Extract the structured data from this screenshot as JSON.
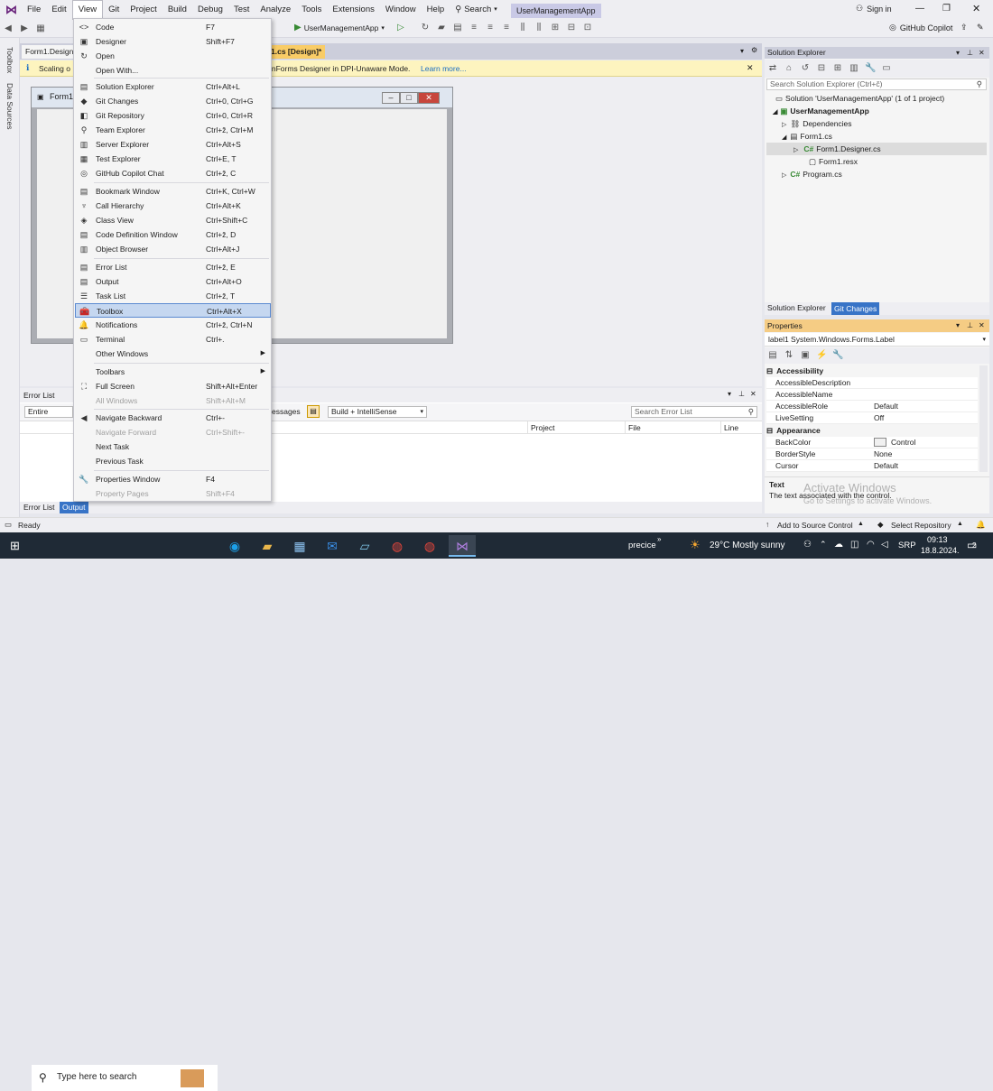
{
  "menubar": {
    "items": [
      "File",
      "Edit",
      "View",
      "Git",
      "Project",
      "Build",
      "Debug",
      "Test",
      "Analyze",
      "Tools",
      "Extensions",
      "Window",
      "Help"
    ],
    "search": "Search",
    "app_title": "UserManagementApp",
    "sign_in": "Sign in",
    "copilot": "GitHub Copilot"
  },
  "toolbar": {
    "run_target": "UserManagementApp"
  },
  "left_strip": {
    "toolbox": "Toolbox",
    "data_sources": "Data Sources"
  },
  "doc": {
    "tab_designer": "Form1.Designe",
    "tab_cs": "1.cs [Design]*",
    "info_prefix": "Scaling o",
    "info_text": "inForms Designer in DPI-Unaware Mode.",
    "info_link": "Learn more...",
    "form_title": "Form1"
  },
  "view_menu": {
    "items": [
      {
        "label": "Code",
        "key": "F7",
        "icon": "<>"
      },
      {
        "label": "Designer",
        "key": "Shift+F7",
        "icon": "▣"
      },
      {
        "label": "Open",
        "key": "",
        "icon": "↻"
      },
      {
        "label": "Open With...",
        "key": "",
        "icon": ""
      },
      {
        "label": "Solution Explorer",
        "key": "Ctrl+Alt+L",
        "icon": "▤"
      },
      {
        "label": "Git Changes",
        "key": "Ctrl+0, Ctrl+G",
        "icon": "◆"
      },
      {
        "label": "Git Repository",
        "key": "Ctrl+0, Ctrl+R",
        "icon": "◧"
      },
      {
        "label": "Team Explorer",
        "key": "Ctrl+ž, Ctrl+M",
        "icon": "⚲"
      },
      {
        "label": "Server Explorer",
        "key": "Ctrl+Alt+S",
        "icon": "▥"
      },
      {
        "label": "Test Explorer",
        "key": "Ctrl+E, T",
        "icon": "▦"
      },
      {
        "label": "GitHub Copilot Chat",
        "key": "Ctrl+ž, C",
        "icon": "◎"
      },
      {
        "label": "Bookmark Window",
        "key": "Ctrl+K, Ctrl+W",
        "icon": "▤"
      },
      {
        "label": "Call Hierarchy",
        "key": "Ctrl+Alt+K",
        "icon": "♆"
      },
      {
        "label": "Class View",
        "key": "Ctrl+Shift+C",
        "icon": "◈"
      },
      {
        "label": "Code Definition Window",
        "key": "Ctrl+ž, D",
        "icon": "▤"
      },
      {
        "label": "Object Browser",
        "key": "Ctrl+Alt+J",
        "icon": "▥"
      },
      {
        "label": "Error List",
        "key": "Ctrl+ž, E",
        "icon": "▤"
      },
      {
        "label": "Output",
        "key": "Ctrl+Alt+O",
        "icon": "▤"
      },
      {
        "label": "Task List",
        "key": "Ctrl+ž, T",
        "icon": "☰"
      },
      {
        "label": "Toolbox",
        "key": "Ctrl+Alt+X",
        "icon": "🧰"
      },
      {
        "label": "Notifications",
        "key": "Ctrl+ž, Ctrl+N",
        "icon": "🔔"
      },
      {
        "label": "Terminal",
        "key": "Ctrl+.",
        "icon": "▭"
      },
      {
        "label": "Other Windows",
        "key": "",
        "icon": ""
      },
      {
        "label": "Toolbars",
        "key": "",
        "icon": ""
      },
      {
        "label": "Full Screen",
        "key": "Shift+Alt+Enter",
        "icon": "⛶"
      },
      {
        "label": "All Windows",
        "key": "Shift+Alt+M",
        "icon": ""
      },
      {
        "label": "Navigate Backward",
        "key": "Ctrl+-",
        "icon": "◀"
      },
      {
        "label": "Navigate Forward",
        "key": "Ctrl+Shift+-",
        "icon": ""
      },
      {
        "label": "Next Task",
        "key": "",
        "icon": ""
      },
      {
        "label": "Previous Task",
        "key": "",
        "icon": ""
      },
      {
        "label": "Properties Window",
        "key": "F4",
        "icon": "🔧"
      },
      {
        "label": "Property Pages",
        "key": "Shift+F4",
        "icon": ""
      }
    ]
  },
  "error_list": {
    "title": "Error List",
    "scope": "Entire Solutio",
    "messages": "essages",
    "build_filter": "Build + IntelliSense",
    "search_placeholder": "Search Error List",
    "col_project": "Project",
    "col_file": "File",
    "col_line": "Line"
  },
  "bottom_tabs": {
    "error_list": "Error List",
    "output": "Output"
  },
  "solution_explorer": {
    "title": "Solution Explorer",
    "search_placeholder": "Search Solution Explorer (Ctrl+č)",
    "tree": [
      "Solution 'UserManagementApp' (1 of 1 project)",
      "UserManagementApp",
      "Dependencies",
      "Form1.cs",
      "Form1.Designer.cs",
      "Form1.resx",
      "Program.cs"
    ],
    "tab1": "Solution Explorer",
    "tab2": "Git Changes"
  },
  "properties": {
    "title": "Properties",
    "selected": "label1  System.Windows.Forms.Label",
    "cat_accessibility": "Accessibility",
    "cat_appearance": "Appearance",
    "rows_access": [
      [
        "AccessibleDescription",
        ""
      ],
      [
        "AccessibleName",
        ""
      ],
      [
        "AccessibleRole",
        "Default"
      ],
      [
        "LiveSetting",
        "Off"
      ]
    ],
    "rows_appear": [
      [
        "BackColor",
        "Control"
      ],
      [
        "BorderStyle",
        "None"
      ],
      [
        "Cursor",
        "Default"
      ]
    ],
    "desc_title": "Text",
    "desc_text": "The text associated with the control.",
    "watermark1": "Activate Windows",
    "watermark2": "Go to Settings to activate Windows."
  },
  "status": {
    "ready": "Ready",
    "add_source": "Add to Source Control",
    "select_repo": "Select Repository"
  },
  "taskbar": {
    "search": "Type here to search",
    "precice": "precice",
    "weather": "29°C  Mostly sunny",
    "lang": "SRP",
    "time": "09:13",
    "date": "18.8.2024.",
    "notif_count": "2"
  }
}
